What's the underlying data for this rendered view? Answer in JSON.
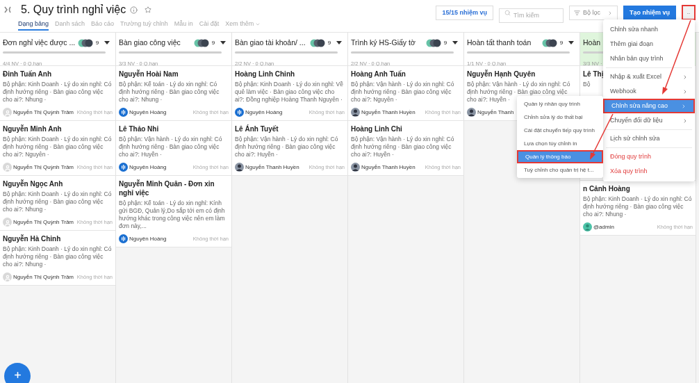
{
  "header": {
    "title": "5. Quy trình nghỉ việc",
    "tabs": [
      {
        "label": "Dạng bảng",
        "selected": true
      },
      {
        "label": "Danh sách",
        "selected": false
      },
      {
        "label": "Báo cáo",
        "selected": false
      },
      {
        "label": "Trường tuỳ chỉnh",
        "selected": false
      },
      {
        "label": "Mẫu in",
        "selected": false
      },
      {
        "label": "Cài đặt",
        "selected": false
      },
      {
        "label": "Xem thêm",
        "selected": false,
        "dropdown": true
      }
    ],
    "task_count": "15/15 nhiệm vụ",
    "search": {
      "placeholder": "Tìm kiếm"
    },
    "filter": "Bộ lọc",
    "create": "Tạo nhiệm vụ",
    "more": {
      "label": "..",
      "annotated": true
    }
  },
  "columns": [
    {
      "title": "Đơn nghỉ việc được ...",
      "member_count": "9",
      "meta": "4/4 NV · 0 Q.hạn",
      "done": false,
      "cards": [
        {
          "title": "Đinh Tuấn Anh",
          "description": "Bộ phận: Kinh Doanh · Lý do xin nghỉ: Có định hướng riêng · Bàn giao công việc cho ai?: Nhung ·",
          "avatar": {
            "kind": "default"
          },
          "assignee": "Nguyễn Thị Quỳnh Trâm",
          "deadline": "Không thời hạn"
        },
        {
          "title": "Nguyễn Minh Anh",
          "description": "Bộ phận: Kinh Doanh · Lý do xin nghỉ: Có định hướng riêng · Bàn giao công việc cho ai?: Nguyên ·",
          "avatar": {
            "kind": "default"
          },
          "assignee": "Nguyễn Thị Quỳnh Trâm",
          "deadline": "Không thời hạn"
        },
        {
          "title": "Nguyễn Ngọc Anh",
          "description": "Bộ phận: Kinh Doanh · Lý do xin nghỉ: Có định hướng riêng · Bàn giao công việc cho ai?: Nhung ·",
          "avatar": {
            "kind": "default"
          },
          "assignee": "Nguyễn Thị Quỳnh Trâm",
          "deadline": "Không thời hạn"
        },
        {
          "title": "Nguyễn Hà Chinh",
          "description": "Bộ phận: Kinh Doanh · Lý do xin nghỉ: Có định hướng riêng · Bàn giao công việc cho ai?: Nhung ·",
          "avatar": {
            "kind": "default"
          },
          "assignee": "Nguyễn Thị Quỳnh Trâm",
          "deadline": "Không thời hạn"
        }
      ]
    },
    {
      "title": "Bàn giao công việc",
      "member_count": "9",
      "meta": "3/3 NV · 0 Q.hạn",
      "done": false,
      "cards": [
        {
          "title": "Nguyễn Hoài Nam",
          "description": "Bộ phận: Kế toán · Lý do xin nghỉ: Có định hướng riêng · Bàn giao công việc cho ai?: Nhung ·",
          "avatar": {
            "kind": "logo"
          },
          "assignee": "Nguyên Hoàng",
          "deadline": "Không thời hạn"
        },
        {
          "title": "Lê Thảo Nhi",
          "description": "Bộ phận: Vận hành · Lý do xin nghỉ: Có định hướng riêng · Bàn giao công việc cho ai?: Huyền ·",
          "avatar": {
            "kind": "logo"
          },
          "assignee": "Nguyên Hoàng",
          "deadline": "Không thời hạn"
        },
        {
          "title": "Nguyễn Minh Quân - Đơn xin nghỉ việc",
          "description": "Bộ phận: Kế toán · Lý do xin nghỉ: Kính gửi BGĐ, Quản lý,Do sắp tới em có định hướng khác trong công việc nên em làm đơn này,...",
          "avatar": {
            "kind": "logo"
          },
          "assignee": "Nguyên Hoàng",
          "deadline": "Không thời hạn"
        }
      ]
    },
    {
      "title": "Bàn giao tài khoản/ ...",
      "member_count": "9",
      "meta": "2/2 NV · 0 Q.hạn",
      "done": false,
      "cards": [
        {
          "title": "Hoàng Linh Chinh",
          "description": "Bộ phận: Kinh Doanh · Lý do xin nghỉ: Về quê làm việc · Bàn giao công việc cho ai?: Đồng nghiệp Hoàng Thanh Nguyên ·",
          "avatar": {
            "kind": "logo"
          },
          "assignee": "Nguyên Hoàng",
          "deadline": "Không thời hạn"
        },
        {
          "title": "Lê Ánh Tuyết",
          "description": "Bộ phận: Vận hành · Lý do xin nghỉ: Có định hướng riêng · Bàn giao công việc cho ai?: Huyền ·",
          "avatar": {
            "kind": "photo"
          },
          "assignee": "Nguyễn Thanh Huyền",
          "deadline": "Không thời hạn"
        }
      ]
    },
    {
      "title": "Trình ký HS-Giấy tờ",
      "member_count": "9",
      "meta": "2/2 NV · 0 Q.hạn",
      "done": false,
      "cards": [
        {
          "title": "Hoàng Anh Tuấn",
          "description": "Bộ phận: Vận hành · Lý do xin nghỉ: Có định hướng riêng · Bàn giao công việc cho ai?: Nguyên ·",
          "avatar": {
            "kind": "photo"
          },
          "assignee": "Nguyễn Thanh Huyền",
          "deadline": "Không thời hạn"
        },
        {
          "title": "Hoàng Linh Chi",
          "description": "Bộ phận: Vận hành · Lý do xin nghỉ: Có định hướng riêng · Bàn giao công việc cho ai?: Huyền ·",
          "avatar": {
            "kind": "photo"
          },
          "assignee": "Nguyễn Thanh Huyền",
          "deadline": "Không thời hạn"
        }
      ]
    },
    {
      "title": "Hoàn tất thanh toán",
      "member_count": "9",
      "meta": "1/1 NV · 0 Q.hạn",
      "done": false,
      "cards": [
        {
          "title": "Nguyễn Hạnh Quyên",
          "description": "Bộ phận: Vận hành · Lý do xin nghỉ: Có định hướng riêng · Bàn giao công việc cho ai?: Huyền ·",
          "avatar": {
            "kind": "photo"
          },
          "assignee": "Nguyễn Thanh"
        }
      ]
    },
    {
      "title": "Hoàn",
      "meta": "3/3 NV ·",
      "done": true,
      "cards": [
        {
          "title": "Lê Thị",
          "description": "Bộ"
        },
        {
          "title": "n Cảnh Hoàng",
          "description": "Bộ phận: Kinh Doanh · Lý do xin nghỉ: Có định hướng riêng · Bàn giao công việc cho ai?: Nhung ·",
          "avatar": {
            "kind": "teal"
          },
          "assignee": "@admin",
          "deadline": "Không thời hạn"
        }
      ]
    }
  ],
  "menu": {
    "items": [
      {
        "label": "Chỉnh sửa nhanh",
        "kind": "item",
        "selected": false
      },
      {
        "label": "Thêm giai đoạn",
        "kind": "item",
        "selected": false
      },
      {
        "label": "Nhân bản quy trình",
        "kind": "item",
        "selected": false
      },
      {
        "label": "Nhập & xuất Excel",
        "kind": "submenu",
        "selected": false,
        "divider_before": true
      },
      {
        "label": "Webhook",
        "kind": "submenu",
        "selected": false
      },
      {
        "label": "Chỉnh sửa nâng cao",
        "kind": "submenu",
        "selected": true
      },
      {
        "label": "Chuyển đổi dữ liệu",
        "kind": "submenu",
        "selected": false
      },
      {
        "label": "Lịch sử chỉnh sửa",
        "kind": "item",
        "selected": false,
        "divider_before": true
      },
      {
        "label": "Đóng quy trình",
        "kind": "danger",
        "selected": false,
        "divider_before": true
      },
      {
        "label": "Xóa quy trình",
        "kind": "danger",
        "selected": false
      }
    ]
  },
  "submenu": {
    "items": [
      {
        "label": "Quản lý nhân quy trình",
        "selected": false
      },
      {
        "label": "Chỉnh sửa lý do thất bại",
        "selected": false
      },
      {
        "label": "Cài đặt chuyển tiếp quy trình",
        "selected": false
      },
      {
        "label": "Lựa chọn tùy chỉnh in",
        "selected": false
      },
      {
        "label": "Quản lý thông báo",
        "selected": true
      },
      {
        "label": "Tuỳ chỉnh cho quản trị hệ t...",
        "selected": false
      }
    ]
  }
}
